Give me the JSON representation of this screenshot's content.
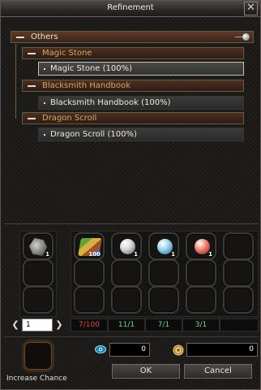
{
  "window": {
    "title": "Refinement",
    "close_glyph": "✕"
  },
  "tree": {
    "root": {
      "label": "Others"
    },
    "groups": [
      {
        "label": "Magic Stone",
        "item": "Magic Stone (100%)",
        "selected": true
      },
      {
        "label": "Blacksmith Handbook",
        "item": "Blacksmith Handbook (100%)",
        "selected": false
      },
      {
        "label": "Dragon Scroll",
        "item": "Dragon Scroll (100%)",
        "selected": false
      }
    ]
  },
  "materials": {
    "result_qty": "1",
    "slots": [
      {
        "icon": "magic-book-icon",
        "qty": "100"
      },
      {
        "icon": "white-orb-icon",
        "qty": "1"
      },
      {
        "icon": "blue-orb-icon",
        "qty": "1"
      },
      {
        "icon": "red-orb-icon",
        "qty": "1"
      }
    ],
    "counts": [
      "7/100",
      "11/1",
      "7/1",
      "3/1",
      ""
    ],
    "count_colors": {
      "insufficient": "#e04a42",
      "sufficient": "#7fd08a"
    }
  },
  "quantity": {
    "value": "1",
    "prev_glyph": "❮",
    "next_glyph": "❯"
  },
  "bottom": {
    "increase_chance_label": "Increase Chance",
    "eye_value": "0",
    "coin_value": "0",
    "ok_label": "OK",
    "cancel_label": "Cancel"
  }
}
